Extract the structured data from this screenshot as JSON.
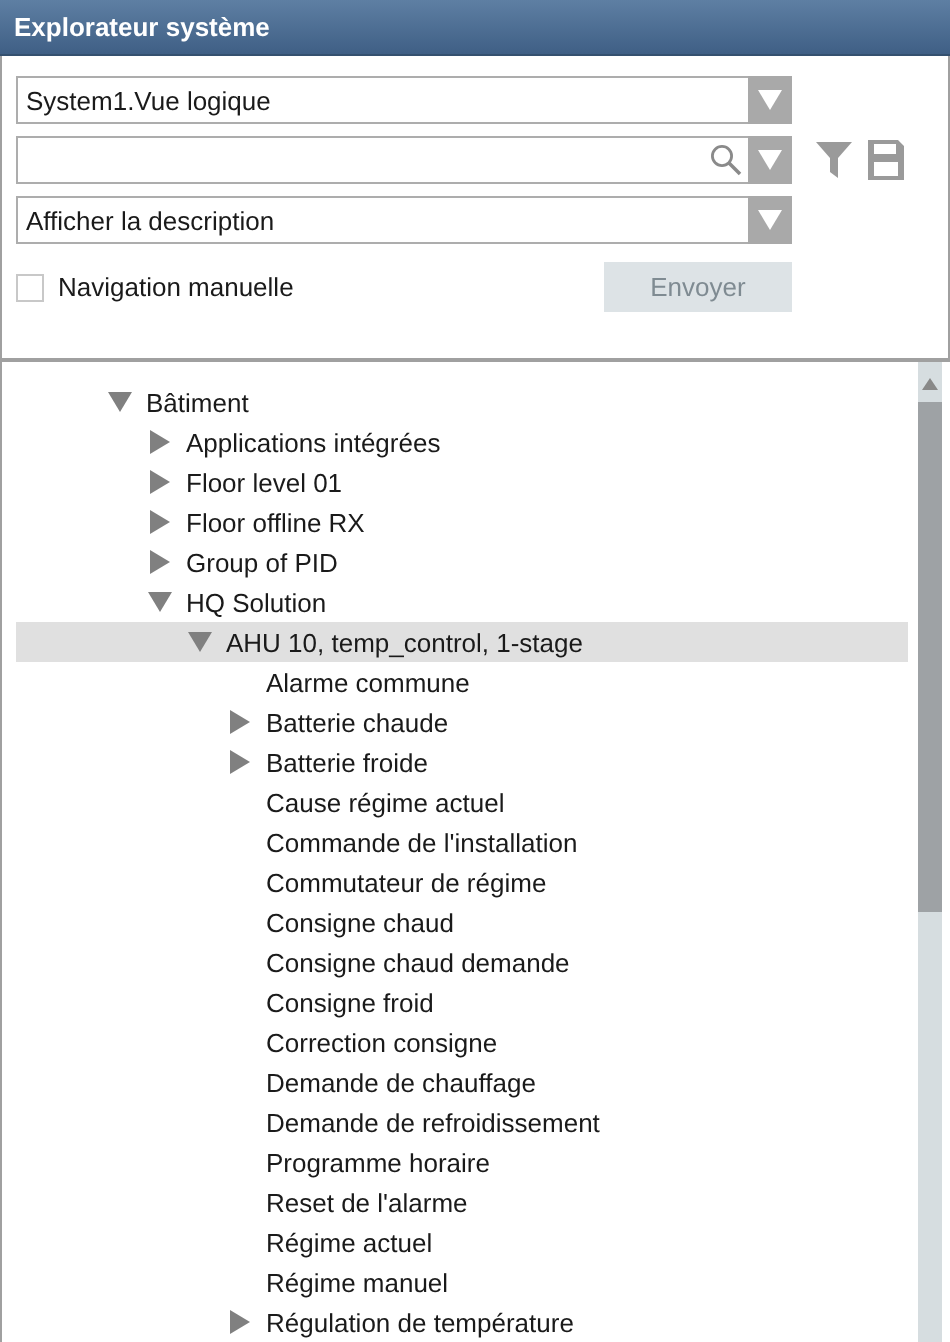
{
  "window": {
    "title": "Explorateur système"
  },
  "controls": {
    "view_select": {
      "value": "System1.Vue logique"
    },
    "display_select": {
      "value": "Afficher la description"
    },
    "manual_navigation": {
      "label": "Navigation manuelle",
      "checked": false
    },
    "send_button": {
      "label": "Envoyer",
      "disabled": true
    }
  },
  "tree": [
    {
      "label": "Bâtiment",
      "expanded": true,
      "selected": false,
      "children": [
        {
          "label": "Applications intégrées",
          "expanded": false,
          "selected": false
        },
        {
          "label": "Floor level 01",
          "expanded": false,
          "selected": false
        },
        {
          "label": "Floor offline RX",
          "expanded": false,
          "selected": false
        },
        {
          "label": "Group of PID",
          "expanded": false,
          "selected": false
        },
        {
          "label": "HQ Solution",
          "expanded": true,
          "selected": false,
          "children": [
            {
              "label": "AHU 10, temp_control, 1-stage",
              "expanded": true,
              "selected": true,
              "children": [
                {
                  "label": "Alarme commune",
                  "selected": false
                },
                {
                  "label": "Batterie chaude",
                  "expanded": false,
                  "selected": false
                },
                {
                  "label": "Batterie froide",
                  "expanded": false,
                  "selected": false
                },
                {
                  "label": "Cause régime actuel",
                  "selected": false
                },
                {
                  "label": "Commande de l'installation",
                  "selected": false
                },
                {
                  "label": "Commutateur de régime",
                  "selected": false
                },
                {
                  "label": "Consigne chaud",
                  "selected": false
                },
                {
                  "label": "Consigne chaud demande",
                  "selected": false
                },
                {
                  "label": "Consigne froid",
                  "selected": false
                },
                {
                  "label": "Correction consigne",
                  "selected": false
                },
                {
                  "label": "Demande de chauffage",
                  "selected": false
                },
                {
                  "label": "Demande de refroidissement",
                  "selected": false
                },
                {
                  "label": "Programme horaire",
                  "selected": false
                },
                {
                  "label": "Reset de l'alarme",
                  "selected": false
                },
                {
                  "label": "Régime actuel",
                  "selected": false
                },
                {
                  "label": "Régime manuel",
                  "selected": false
                },
                {
                  "label": "Régulation de température",
                  "expanded": false,
                  "selected": false
                }
              ]
            }
          ]
        }
      ]
    }
  ]
}
